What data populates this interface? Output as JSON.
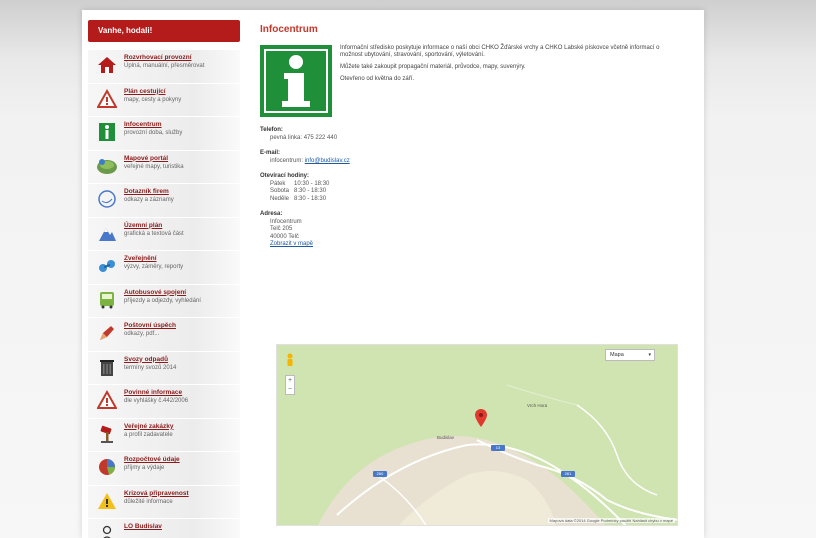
{
  "sidebar": {
    "header": "Vanhe, hodali!",
    "items": [
      {
        "title": "Rozvrhovací provozní",
        "sub": "Úplná, manuální, přesměrovat",
        "icon": "house-icon"
      },
      {
        "title": "Plán cestující",
        "sub": "mapy, cesty a pokyny",
        "icon": "warning-triangle-icon"
      },
      {
        "title": "Infocentrum",
        "sub": "provozní doba, služby",
        "icon": "info-icon"
      },
      {
        "title": "Mapové portál",
        "sub": "veřejné mapy, turistika",
        "icon": "globe-icon"
      },
      {
        "title": "Dotazník firem",
        "sub": "odkazy a záznamy",
        "icon": "chat-icon"
      },
      {
        "title": "Územní plán",
        "sub": "grafická a textová část",
        "icon": "mountain-icon"
      },
      {
        "title": "Zveřejnění",
        "sub": "výzvy, záměry, reporty",
        "icon": "link-icon"
      },
      {
        "title": "Autobusové spojení",
        "sub": "příjezdy a odjezdy, vyhledání",
        "icon": "bus-icon"
      },
      {
        "title": "Poštovní úspěch",
        "sub": "odkazy, pdf...",
        "icon": "pen-icon"
      },
      {
        "title": "Svozy odpadů",
        "sub": "termíny svozů 2014",
        "icon": "bin-icon"
      },
      {
        "title": "Povinné informace",
        "sub": "dle vyhlášky č.442/2006",
        "icon": "warning-triangle-icon"
      },
      {
        "title": "Veřejné zakázky",
        "sub": "a profil zadavatele",
        "icon": "gavel-icon"
      },
      {
        "title": "Rozpočtové údaje",
        "sub": "příjmy a výdaje",
        "icon": "chart-icon"
      },
      {
        "title": "Krizová připravenost",
        "sub": "důležité informace",
        "icon": "yellow-warning-icon"
      },
      {
        "title": "LO Budislav",
        "sub": "",
        "icon": "person-icon"
      }
    ]
  },
  "main": {
    "title": "Infocentrum",
    "intro": [
      "Informační středisko poskytuje informace o naší obci CHKO Žďárské vrchy a CHKO Labské pískovce včetně informací o možnost ubytování, stravování, sportování, výletování.",
      "Můžete také zakoupit propagační materiál, průvodce, mapy, suvenýry.",
      "Otevřeno od května do září."
    ],
    "phone_label": "Telefon:",
    "phone_value": "pevná linka: 475 222 440",
    "email_label": "E-mail:",
    "email_prefix": "infocentrum:",
    "email_value": "info@budislav.cz",
    "hours_label": "Otevírací hodiny:",
    "hours": [
      {
        "day": "Pátek",
        "time": "10:30 - 18:30"
      },
      {
        "day": "Sobota",
        "time": "8:30 - 18:30"
      },
      {
        "day": "Neděle",
        "time": "8:30 - 18:30"
      }
    ],
    "address_label": "Adresa:",
    "address_lines": [
      "Infocentrum",
      "Telč 205",
      "40000 Telč"
    ],
    "address_link": "Zobrazit v mapě"
  },
  "map": {
    "type_select": "Mapa",
    "place_label": "Budislav",
    "hill_label": "Vrch Hora",
    "roads": [
      "260",
      "13",
      "261"
    ],
    "footer": "Mapová data ©2014 Google  Podmínky použití  Nahlásit chybu v mapě",
    "colors": {
      "land": "#cfe4b0",
      "urban": "#e8e0d0",
      "road": "#ffffff",
      "water": "#a9c7ee",
      "marker": "#e03a2f"
    }
  },
  "colors": {
    "accent": "#b41b1b",
    "title": "#c0392b",
    "info_green": "#1f8f3a",
    "link": "#1f5aa6"
  }
}
